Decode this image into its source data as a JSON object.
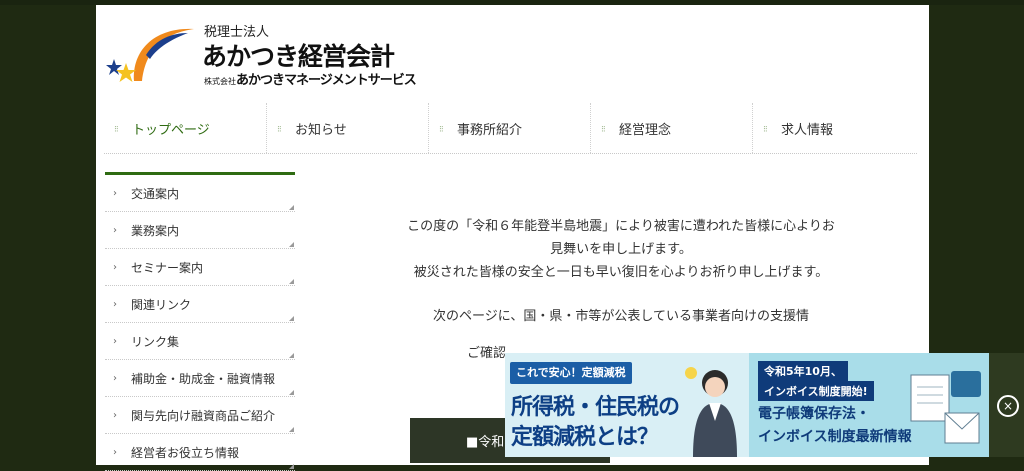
{
  "logo": {
    "line1": "税理士法人",
    "line2": "あかつき経営会計",
    "line3_prefix": "株式会社",
    "line3_main": "あかつきマネージメントサービス"
  },
  "nav": {
    "items": [
      {
        "label": "トップページ"
      },
      {
        "label": "お知らせ"
      },
      {
        "label": "事務所紹介"
      },
      {
        "label": "経営理念"
      },
      {
        "label": "求人情報"
      }
    ]
  },
  "sidebar": {
    "items": [
      {
        "label": "交通案内"
      },
      {
        "label": "業務案内"
      },
      {
        "label": "セミナー案内"
      },
      {
        "label": "関連リンク"
      },
      {
        "label": "リンク集"
      },
      {
        "label": "補助金・助成金・融資情報"
      },
      {
        "label": "関与先向け融資商品ご紹介"
      },
      {
        "label": "経営者お役立ち情報"
      }
    ]
  },
  "main": {
    "p1": "この度の「令和６年能登半島地震」により被害に遭われた皆様に心よりお見舞いを申し上げます。",
    "p2": "被災された皆様の安全と一日も早い復旧を心よりお祈り申し上げます。",
    "p3": "次のページに、国・県・市等が公表している事業者向けの支援情",
    "p4": "ご確認",
    "button": "■令和"
  },
  "ad": {
    "tag": "これで安心！定額減税",
    "headline1": "所得税・住民税の",
    "headline2": "定額減税とは？",
    "right_tag1": "令和5年10月、",
    "right_tag2": "インボイス制度開始!",
    "right_line1": "電子帳簿保存法・",
    "right_line2": "インボイス制度最新情報",
    "close": "×"
  }
}
